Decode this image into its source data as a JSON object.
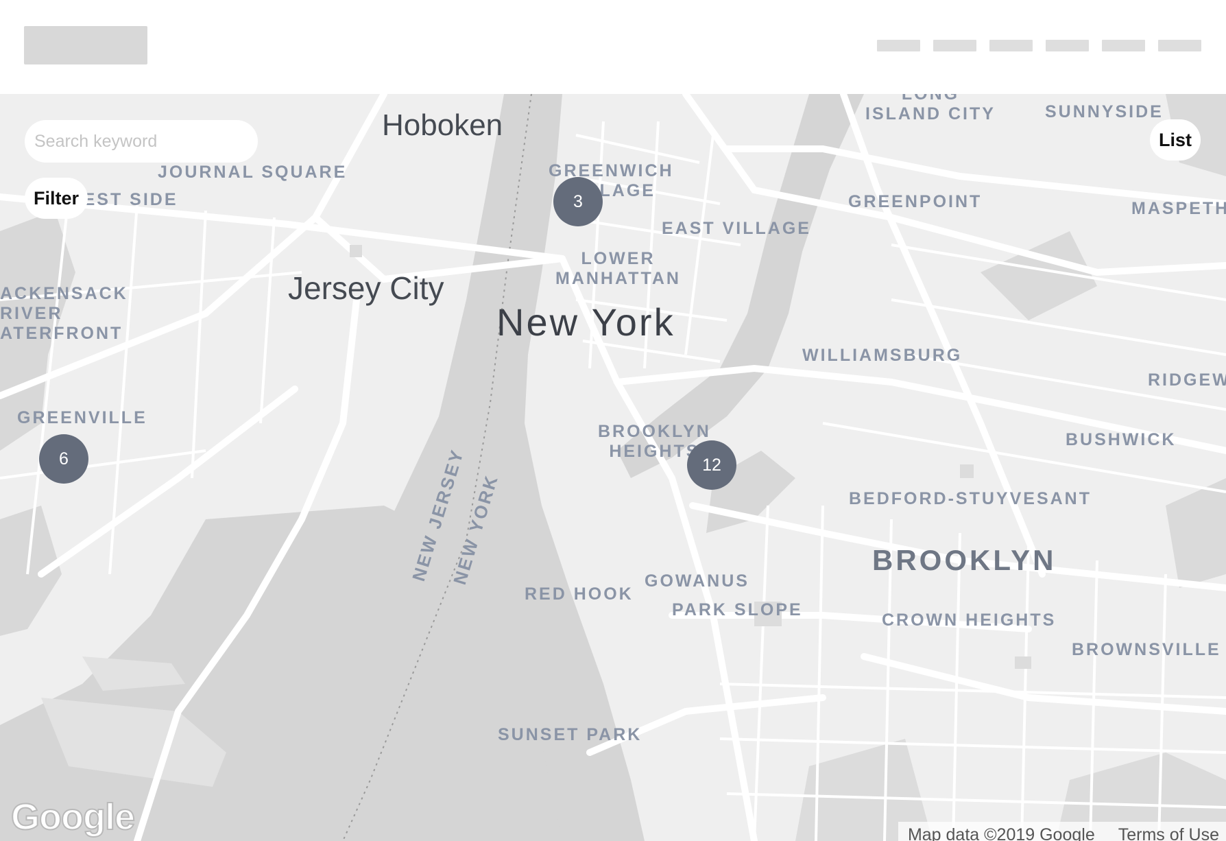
{
  "header": {
    "nav_count": 6
  },
  "search": {
    "placeholder": "Search keyword"
  },
  "controls": {
    "filter_label": "Filter",
    "list_label": "List"
  },
  "map": {
    "places": {
      "hoboken": "Hoboken",
      "journal_square": "JOURNAL SQUARE",
      "west_side": "WEST SIDE",
      "hackensack": "ACKENSACK\nRIVER\nATERFRONT",
      "jersey_city": "Jersey City",
      "greenville": "GREENVILLE",
      "greenwich_village": "GREENWICH\nVILLAGE",
      "east_village": "EAST VILLAGE",
      "lower_manhattan": "LOWER\nMANHATTAN",
      "new_york": "New York",
      "long_island_city": "LONG\nISLAND CITY",
      "sunnyside": "SUNNYSIDE",
      "greenpoint": "GREENPOINT",
      "maspeth": "MASPETH",
      "williamsburg": "WILLIAMSBURG",
      "ridgewood": "RIDGEWOOD",
      "bushwick": "BUSHWICK",
      "brooklyn_heights": "BROOKLYN\nHEIGHTS",
      "bedford_stuyvesant": "BEDFORD-STUYVESANT",
      "brooklyn": "BROOKLYN",
      "gowanus": "GOWANUS",
      "red_hook": "RED HOOK",
      "park_slope": "PARK SLOPE",
      "crown_heights": "CROWN HEIGHTS",
      "brownsville": "BROWNSVILLE",
      "sunset_park": "SUNSET PARK",
      "new_jersey": "NEW JERSEY",
      "new_york_state": "NEW YORK"
    },
    "clusters": [
      {
        "id": "cluster-3",
        "count": "3"
      },
      {
        "id": "cluster-6",
        "count": "6"
      },
      {
        "id": "cluster-12",
        "count": "12"
      }
    ],
    "google_logo": "Google",
    "attribution": "Map data ©2019 Google",
    "terms": "Terms of Use"
  }
}
